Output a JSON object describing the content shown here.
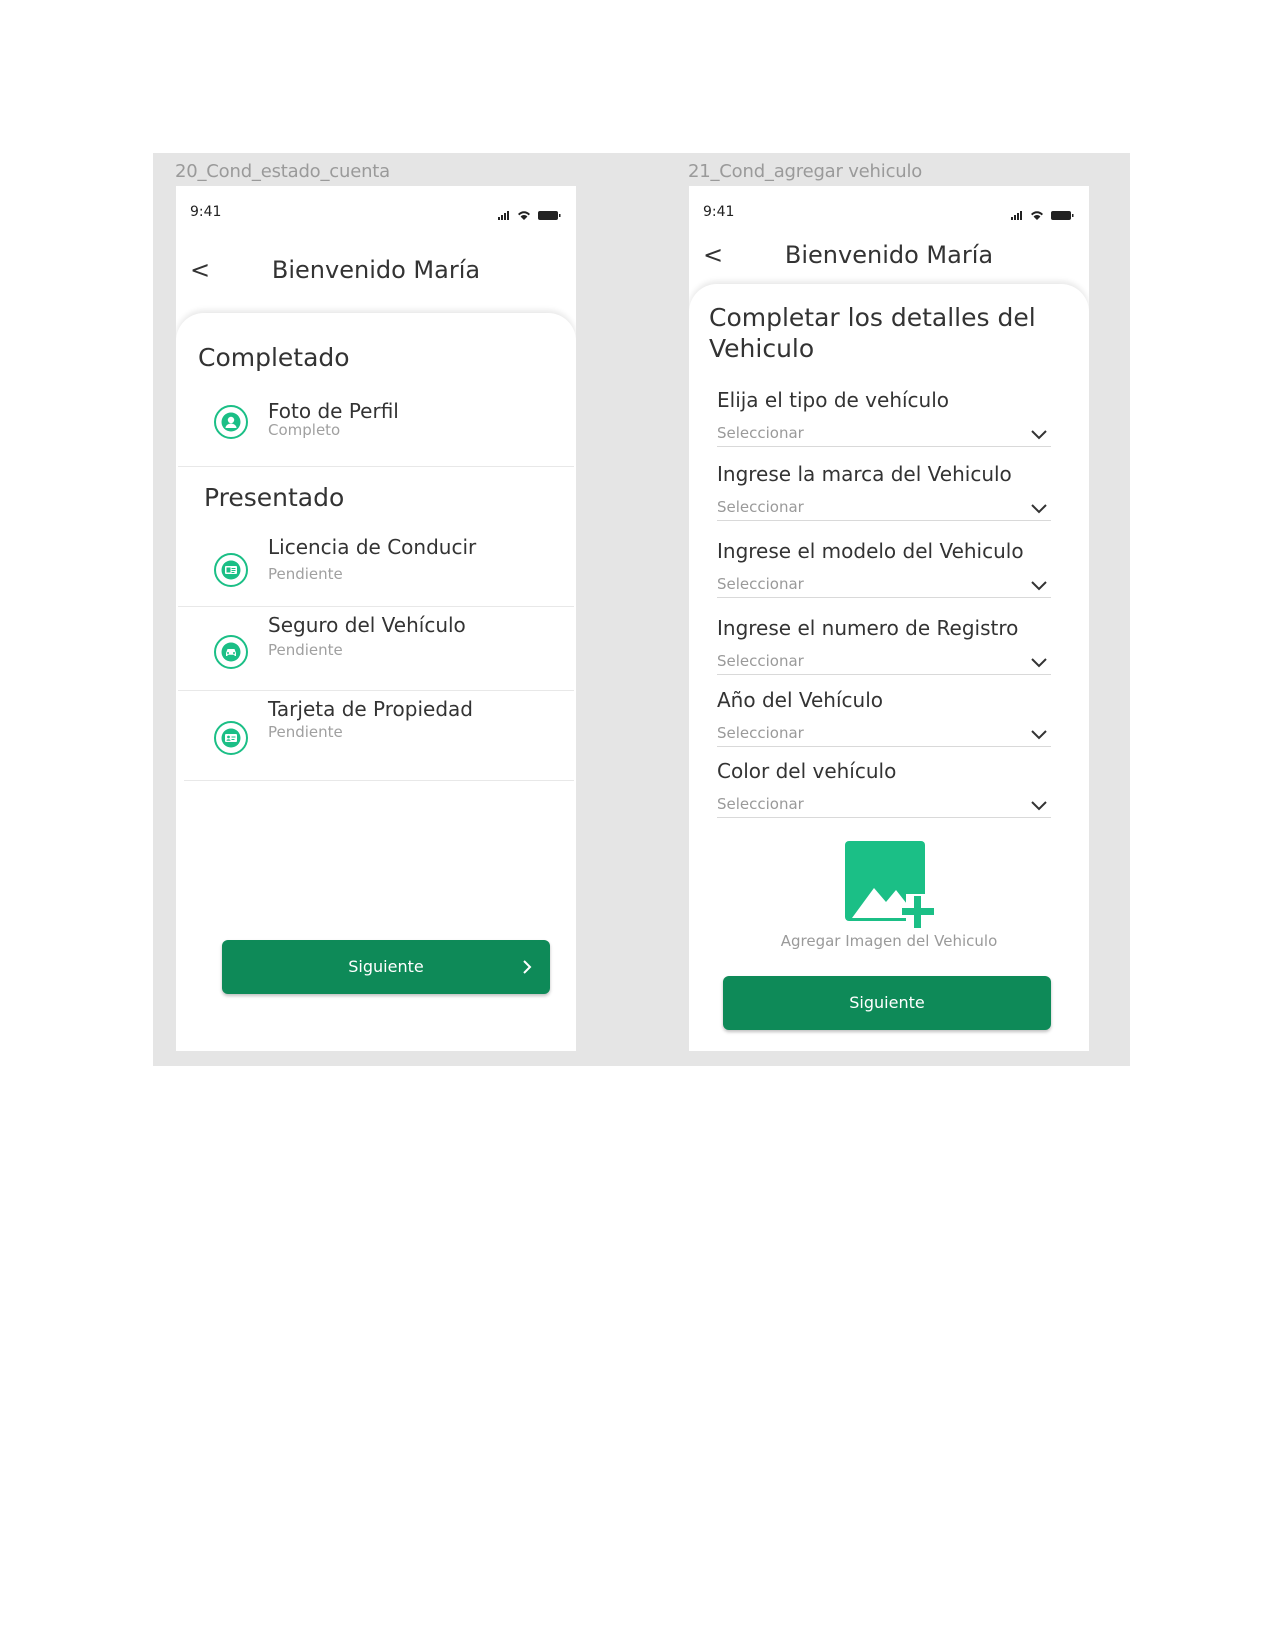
{
  "frames": [
    {
      "label": "20_Cond_estado_cuenta",
      "status_time": "9:41",
      "header_title": "Bienvenido María",
      "sections": [
        {
          "title": "Completado",
          "items": [
            {
              "title": "Foto de Perfil",
              "status": "Completo",
              "icon": "user-icon"
            }
          ]
        },
        {
          "title": "Presentado",
          "items": [
            {
              "title": "Licencia de Conducir",
              "status": "Pendiente",
              "icon": "id-card-icon"
            },
            {
              "title": "Seguro del Vehículo",
              "status": "Pendiente",
              "icon": "car-icon"
            },
            {
              "title": "Tarjeta de Propiedad",
              "status": "Pendiente",
              "icon": "property-card-icon"
            }
          ]
        }
      ],
      "next_button": "Siguiente"
    },
    {
      "label": "21_Cond_agregar vehiculo",
      "status_time": "9:41",
      "header_title": "Bienvenido María",
      "sheet_title": "Completar los detalles del Vehiculo",
      "fields": [
        {
          "label": "Elija el tipo de vehículo",
          "value": "Seleccionar"
        },
        {
          "label": "Ingrese la marca del Vehiculo",
          "value": "Seleccionar"
        },
        {
          "label": "Ingrese el modelo del Vehiculo",
          "value": "Seleccionar"
        },
        {
          "label": "Ingrese el numero de Registro",
          "value": "Seleccionar"
        },
        {
          "label": "Año del Vehículo",
          "value": "Seleccionar"
        },
        {
          "label": "Color del vehículo",
          "value": "Seleccionar"
        }
      ],
      "add_image_label": "Agregar Imagen del Vehiculo",
      "next_button": "Siguiente"
    }
  ],
  "colors": {
    "accent": "#1bbf86",
    "button": "#0e8a58",
    "canvas": "#e5e5e5"
  }
}
